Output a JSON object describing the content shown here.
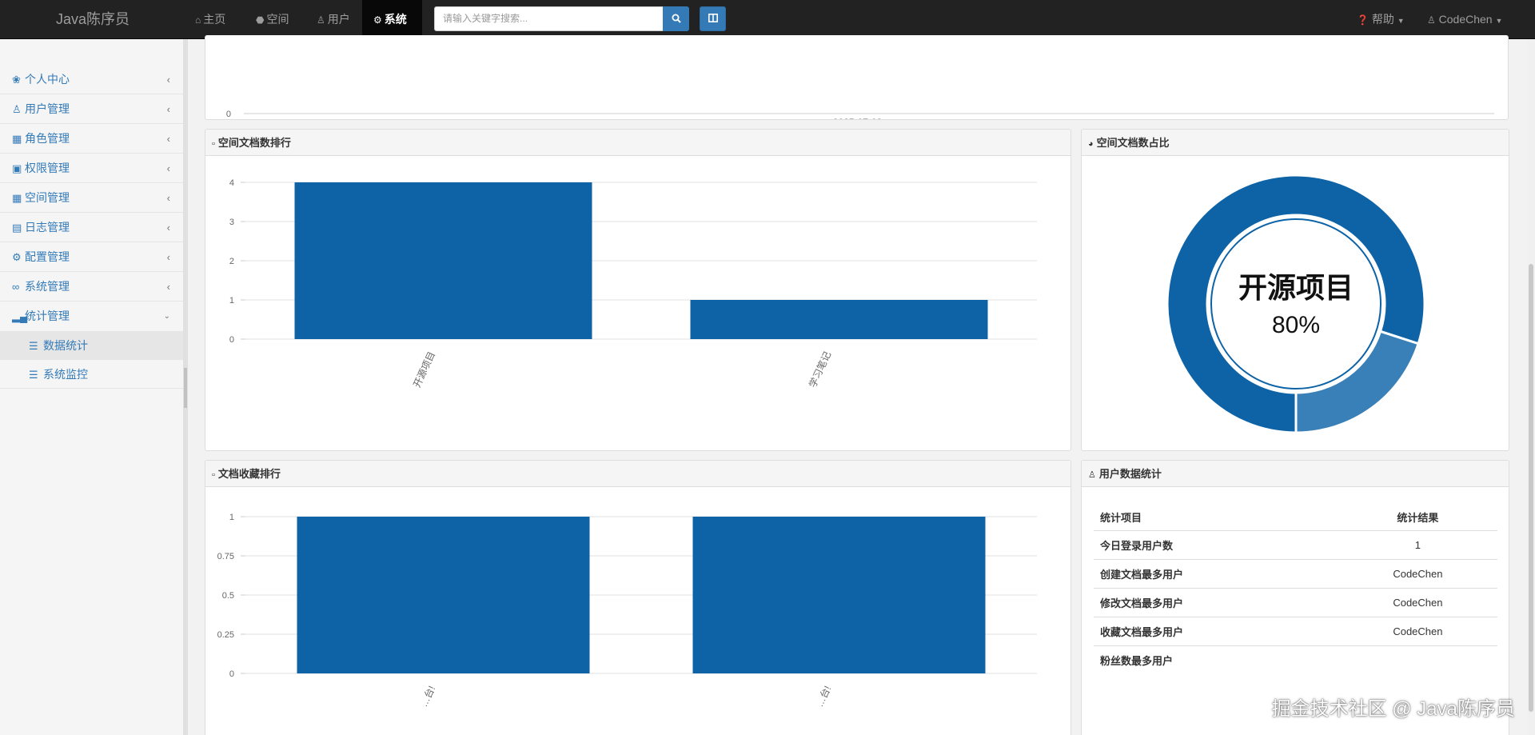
{
  "navbar": {
    "brand": "Java陈序员",
    "items": [
      {
        "icon": "home-icon",
        "label": "主页"
      },
      {
        "icon": "cube-icon",
        "label": "空间"
      },
      {
        "icon": "user-icon",
        "label": "用户"
      },
      {
        "icon": "gear-icon",
        "label": "系统",
        "active": true
      }
    ],
    "search_placeholder": "请输入关键字搜索...",
    "help_label": "帮助",
    "user_label": "CodeChen"
  },
  "sidebar": {
    "items": [
      {
        "icon": "leaf-icon",
        "label": "个人中心"
      },
      {
        "icon": "user-icon",
        "label": "用户管理"
      },
      {
        "icon": "gift-icon",
        "label": "角色管理"
      },
      {
        "icon": "lock-icon",
        "label": "权限管理"
      },
      {
        "icon": "grid-icon",
        "label": "空间管理"
      },
      {
        "icon": "list-alt-icon",
        "label": "日志管理"
      },
      {
        "icon": "gear-icon",
        "label": "配置管理"
      },
      {
        "icon": "link-icon",
        "label": "系统管理"
      },
      {
        "icon": "signal-icon",
        "label": "统计管理",
        "expanded": true
      }
    ],
    "subitems": [
      {
        "icon": "list-icon",
        "label": "数据统计",
        "active": true
      },
      {
        "icon": "list-icon",
        "label": "系统监控"
      }
    ]
  },
  "top_chart": {
    "y_tick": "0",
    "x_label": "2025-07-03"
  },
  "panels": {
    "space_rank_title": "空间文档数排行",
    "space_ratio_title": "空间文档数占比",
    "favorite_rank_title": "文档收藏排行",
    "user_stats_title": "用户数据统计"
  },
  "chart_data": [
    {
      "type": "bar",
      "title": "空间文档数排行",
      "categories": [
        "开源项目",
        "学习笔记"
      ],
      "values": [
        4,
        1
      ],
      "ylim": [
        0,
        4
      ],
      "yticks": [
        "0",
        "1",
        "2",
        "3",
        "4"
      ],
      "color": "#0d63a6"
    },
    {
      "type": "pie",
      "title": "空间文档数占比",
      "labels": [
        "开源项目",
        "学习笔记"
      ],
      "values": [
        80,
        20
      ],
      "center_label": "开源项目",
      "center_value": "80%",
      "colors": [
        "#0d63a6",
        "#3a80b8"
      ]
    },
    {
      "type": "bar",
      "title": "文档收藏排行",
      "categories": [
        "…台!",
        "…台!"
      ],
      "values": [
        1,
        1
      ],
      "ylim": [
        0,
        1
      ],
      "yticks": [
        "0",
        "0.25",
        "0.5",
        "0.75",
        "1"
      ],
      "color": "#0d63a6"
    }
  ],
  "user_stats": {
    "headers": [
      "统计项目",
      "统计结果"
    ],
    "rows": [
      [
        "今日登录用户数",
        "1"
      ],
      [
        "创建文档最多用户",
        "CodeChen"
      ],
      [
        "修改文档最多用户",
        "CodeChen"
      ],
      [
        "收藏文档最多用户",
        "CodeChen"
      ],
      [
        "粉丝数最多用户",
        ""
      ]
    ]
  },
  "watermark": "掘金技术社区 @ Java陈序员"
}
